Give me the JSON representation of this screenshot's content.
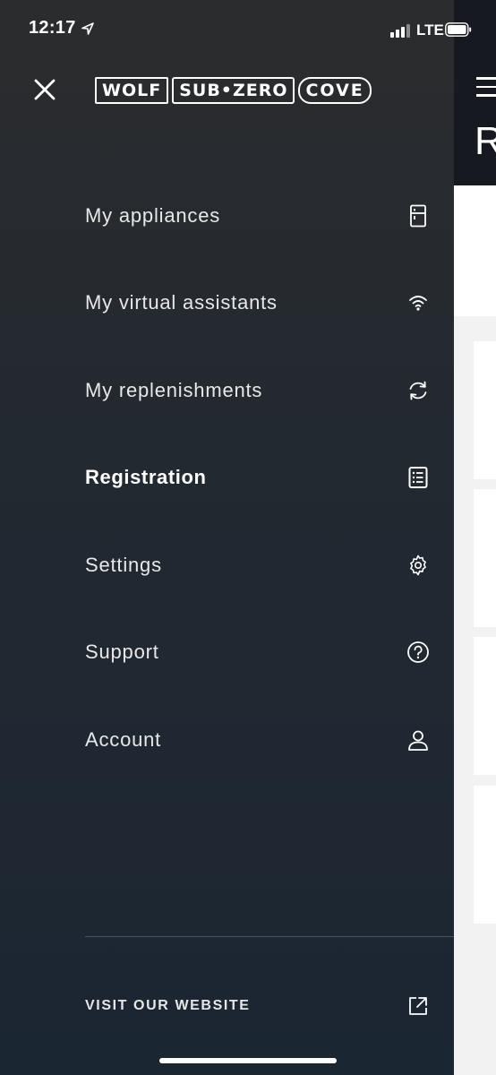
{
  "status_bar": {
    "time": "12:17",
    "network": "LTE"
  },
  "brand": {
    "logos": [
      "WOLF",
      "SUB•ZERO",
      "COVE"
    ]
  },
  "background_page": {
    "title_fragment": "R"
  },
  "menu": {
    "items": [
      {
        "label": "My appliances",
        "icon": "fridge-icon",
        "active": false
      },
      {
        "label": "My virtual assistants",
        "icon": "wifi-icon",
        "active": false
      },
      {
        "label": "My replenishments",
        "icon": "refresh-icon",
        "active": false
      },
      {
        "label": "Registration",
        "icon": "document-list-icon",
        "active": true
      },
      {
        "label": "Settings",
        "icon": "gear-icon",
        "active": false
      },
      {
        "label": "Support",
        "icon": "help-icon",
        "active": false
      },
      {
        "label": "Account",
        "icon": "user-icon",
        "active": false
      }
    ]
  },
  "footer": {
    "website_label": "VISIT OUR WEBSITE",
    "icon": "external-link-icon"
  },
  "colors": {
    "drawer_top": "#2b2c2e",
    "drawer_bottom": "#1b2633",
    "text": "#e8e8e8",
    "divider": "#4a525c"
  }
}
